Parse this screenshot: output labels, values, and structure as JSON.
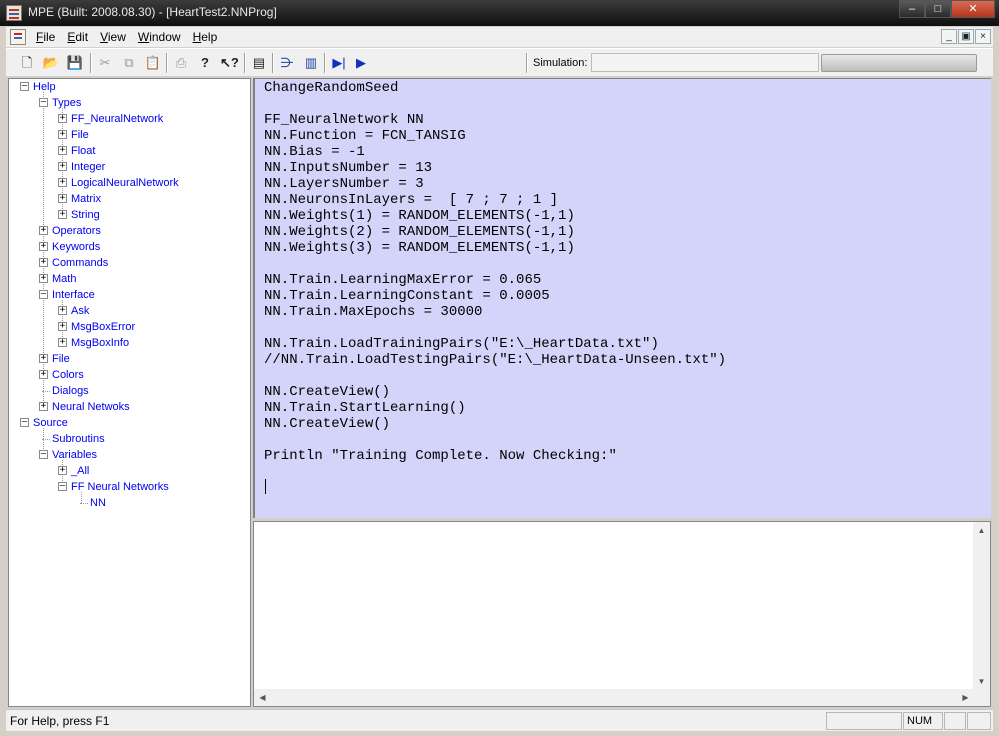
{
  "window": {
    "title": "MPE (Built: 2008.08.30) - [HeartTest2.NNProg]",
    "controls": {
      "minimize": "–",
      "maximize": "□",
      "close": "✕"
    }
  },
  "menubar": {
    "items": [
      {
        "label": "File",
        "underline": "F"
      },
      {
        "label": "Edit",
        "underline": "E"
      },
      {
        "label": "View",
        "underline": "V"
      },
      {
        "label": "Window",
        "underline": "W"
      },
      {
        "label": "Help",
        "underline": "H"
      }
    ],
    "mdi_controls": {
      "minimize": "_",
      "restore": "▣",
      "close": "×"
    }
  },
  "toolbar": {
    "icons": {
      "new": "new-file-icon",
      "open": "open-folder-icon",
      "save": "save-disk-icon",
      "cut": "cut-icon",
      "copy": "copy-icon",
      "paste": "paste-icon",
      "print": "print-icon",
      "about": "about-question-icon",
      "context_help": "context-help-icon",
      "view": "view-panel-icon",
      "network": "network-icon",
      "chart": "bar-chart-icon",
      "step": "step-run-icon",
      "run": "run-icon"
    },
    "simulation_label": "Simulation:",
    "simulation_value": "",
    "progress_fraction": 0.0
  },
  "tree": {
    "nodes": [
      {
        "label": "Help",
        "level": 0,
        "toggle": "–"
      },
      {
        "label": "Types",
        "level": 1,
        "toggle": "–"
      },
      {
        "label": "FF_NeuralNetwork",
        "level": 2,
        "toggle": "+"
      },
      {
        "label": "File",
        "level": 2,
        "toggle": "+"
      },
      {
        "label": "Float",
        "level": 2,
        "toggle": "+"
      },
      {
        "label": "Integer",
        "level": 2,
        "toggle": "+"
      },
      {
        "label": "LogicalNeuralNetwork",
        "level": 2,
        "toggle": "+"
      },
      {
        "label": "Matrix",
        "level": 2,
        "toggle": "+"
      },
      {
        "label": "String",
        "level": 2,
        "toggle": "+"
      },
      {
        "label": "Operators",
        "level": 1,
        "toggle": "+"
      },
      {
        "label": "Keywords",
        "level": 1,
        "toggle": "+"
      },
      {
        "label": "Commands",
        "level": 1,
        "toggle": "+"
      },
      {
        "label": "Math",
        "level": 1,
        "toggle": "+"
      },
      {
        "label": "Interface",
        "level": 1,
        "toggle": "–"
      },
      {
        "label": "Ask",
        "level": 2,
        "toggle": "+"
      },
      {
        "label": "MsgBoxError",
        "level": 2,
        "toggle": "+"
      },
      {
        "label": "MsgBoxInfo",
        "level": 2,
        "toggle": "+"
      },
      {
        "label": "File",
        "level": 1,
        "toggle": "+"
      },
      {
        "label": "Colors",
        "level": 1,
        "toggle": "+"
      },
      {
        "label": "Dialogs",
        "level": 1,
        "toggle": ""
      },
      {
        "label": "Neural Netwoks",
        "level": 1,
        "toggle": "+"
      },
      {
        "label": "Source",
        "level": 0,
        "toggle": "–"
      },
      {
        "label": "Subroutins",
        "level": 1,
        "toggle": ""
      },
      {
        "label": "Variables",
        "level": 1,
        "toggle": "–"
      },
      {
        "label": "_All",
        "level": 2,
        "toggle": "+"
      },
      {
        "label": "FF Neural Networks",
        "level": 2,
        "toggle": "–"
      },
      {
        "label": "NN",
        "level": 3,
        "toggle": ""
      }
    ]
  },
  "editor": {
    "lines": [
      "ChangeRandomSeed",
      "",
      "FF_NeuralNetwork NN",
      "NN.Function = FCN_TANSIG",
      "NN.Bias = -1",
      "NN.InputsNumber = 13",
      "NN.LayersNumber = 3",
      "NN.NeuronsInLayers =  [ 7 ; 7 ; 1 ]",
      "NN.Weights(1) = RANDOM_ELEMENTS(-1,1)",
      "NN.Weights(2) = RANDOM_ELEMENTS(-1,1)",
      "NN.Weights(3) = RANDOM_ELEMENTS(-1,1)",
      "",
      "NN.Train.LearningMaxError = 0.065",
      "NN.Train.LearningConstant = 0.0005",
      "NN.Train.MaxEpochs = 30000",
      "",
      "NN.Train.LoadTrainingPairs(\"E:\\_HeartData.txt\")",
      "//NN.Train.LoadTestingPairs(\"E:\\_HeartData-Unseen.txt\")",
      "",
      "NN.CreateView()",
      "NN.Train.StartLearning()",
      "NN.CreateView()",
      "",
      "Println \"Training Complete. Now Checking:\"",
      "",
      ""
    ],
    "background": "#d4d4fb"
  },
  "output": {
    "text": ""
  },
  "statusbar": {
    "help_text": "For Help, press F1",
    "indicators": [
      "",
      "NUM",
      "",
      ""
    ]
  }
}
